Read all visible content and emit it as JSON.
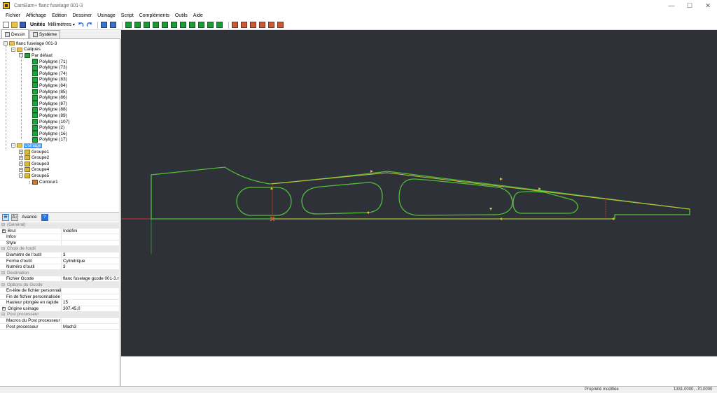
{
  "window": {
    "title": "CamBam+  flanc fuselage 001-3",
    "controls": {
      "minimize": "—",
      "maximize": "☐",
      "close": "✕"
    }
  },
  "menu": [
    "Fichier",
    "Affichage",
    "Edition",
    "Dessiner",
    "Usinage",
    "Script",
    "Compléments",
    "Outils",
    "Aide"
  ],
  "toolbar": {
    "units_label": "Unités",
    "units_value": "Millimètres"
  },
  "tabs": [
    "Dessin",
    "Système"
  ],
  "tree": {
    "root": "flanc fuselage 001-3",
    "layers_label": "Calques",
    "default_layer": "Par défaut",
    "polylines": [
      "Polyligne (71)",
      "Polyligne (73)",
      "Polyligne (74)",
      "Polyligne (83)",
      "Polyligne (84)",
      "Polyligne (85)",
      "Polyligne (86)",
      "Polyligne (87)",
      "Polyligne (88)",
      "Polyligne (89)",
      "Polyligne (107)",
      "Polyligne (2)",
      "Polyligne (16)",
      "Polyligne (17)"
    ],
    "machining_label": "Usinage",
    "groups": [
      "Groupe1",
      "Groupe2",
      "Groupe3",
      "Groupe4",
      "Groupe5"
    ],
    "contour": "Contour1"
  },
  "props_toolbar": {
    "advanced": "Avancé",
    "sort_label": "A↓",
    "help": "?"
  },
  "properties": [
    {
      "cat": "(Général)"
    },
    {
      "name": "Brut",
      "value": "Indéfini",
      "expand": true
    },
    {
      "name": "Infos",
      "value": ""
    },
    {
      "name": "Style",
      "value": ""
    },
    {
      "cat": "Choix de l'outil"
    },
    {
      "name": "Diamètre de l'outil",
      "value": "3"
    },
    {
      "name": "Forme d'outil",
      "value": "Cylindrique"
    },
    {
      "name": "Numéro d'outil",
      "value": "3"
    },
    {
      "cat": "Destination"
    },
    {
      "name": "Fichier Gcode",
      "value": "flanc fuselage gcode 001-3.nc"
    },
    {
      "cat": "Options du Gcode"
    },
    {
      "name": "En-tête de fichier personnalisé",
      "value": ""
    },
    {
      "name": "Fin de fichier personnalisée",
      "value": ""
    },
    {
      "name": "Hauteur plongée en rapide",
      "value": "15"
    },
    {
      "name": "Origine usinage",
      "value": "307.45,0",
      "expand": true
    },
    {
      "cat": "Post processeur"
    },
    {
      "name": "Macros du Post processeur",
      "value": ""
    },
    {
      "name": "Post processeur",
      "value": "Mach3"
    }
  ],
  "status": {
    "left": "Propriété modifiée",
    "right": "1331.0000, -70.0000"
  },
  "colors": {
    "canvas_bg": "#2f3138",
    "geometry": "#4fbf3a",
    "toolpath": "#c8c23a",
    "axis_red": "#c8332a",
    "axis_green": "#2e8b2e"
  }
}
